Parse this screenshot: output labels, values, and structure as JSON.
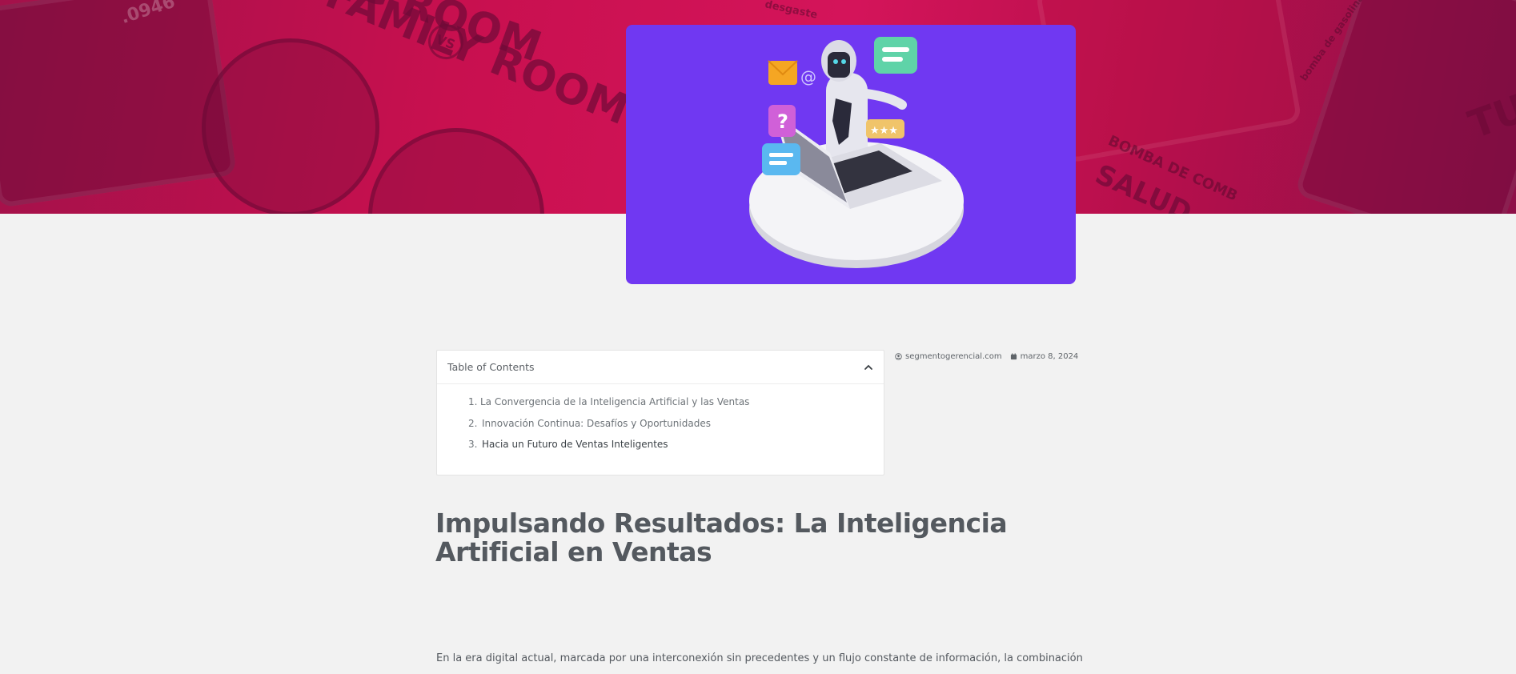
{
  "hero": {
    "background_colors": [
      "#a3114a",
      "#d4145a",
      "#8e1048"
    ],
    "texts": {
      "family_room": "FAMILY ROOM",
      "living_room": "G ROOM",
      "vs": "VS",
      "bomba": "BOMBA DE COMB",
      "salud": "SALUD",
      "phone": ".0946",
      "tu": "TU",
      "desgaste": "desgaste",
      "bomba_gasolina": "bomba de gasolina"
    }
  },
  "feature_image": {
    "icon": "ai-robot-laptop-illustration",
    "background": "#7038f2"
  },
  "toc": {
    "title": "Table of Contents",
    "toggle_icon": "chevron-up-icon",
    "items": [
      {
        "num": "1.",
        "label": "La Convergencia de la Inteligencia Artificial y las Ventas"
      },
      {
        "num": "2.",
        "label": "Innovación Continua: Desafíos y Oportunidades"
      },
      {
        "num": "3.",
        "label": "Hacia un Futuro de Ventas Inteligentes"
      }
    ]
  },
  "meta": {
    "author": "segmentogerencial.com",
    "author_icon": "user-circle-icon",
    "date": "marzo 8, 2024",
    "date_icon": "calendar-icon"
  },
  "article": {
    "title": "Impulsando Resultados: La Inteligencia Artificial en Ventas",
    "first_paragraph": "En la era digital actual, marcada por una interconexión sin precedentes y un flujo constante de información, la combinación"
  }
}
